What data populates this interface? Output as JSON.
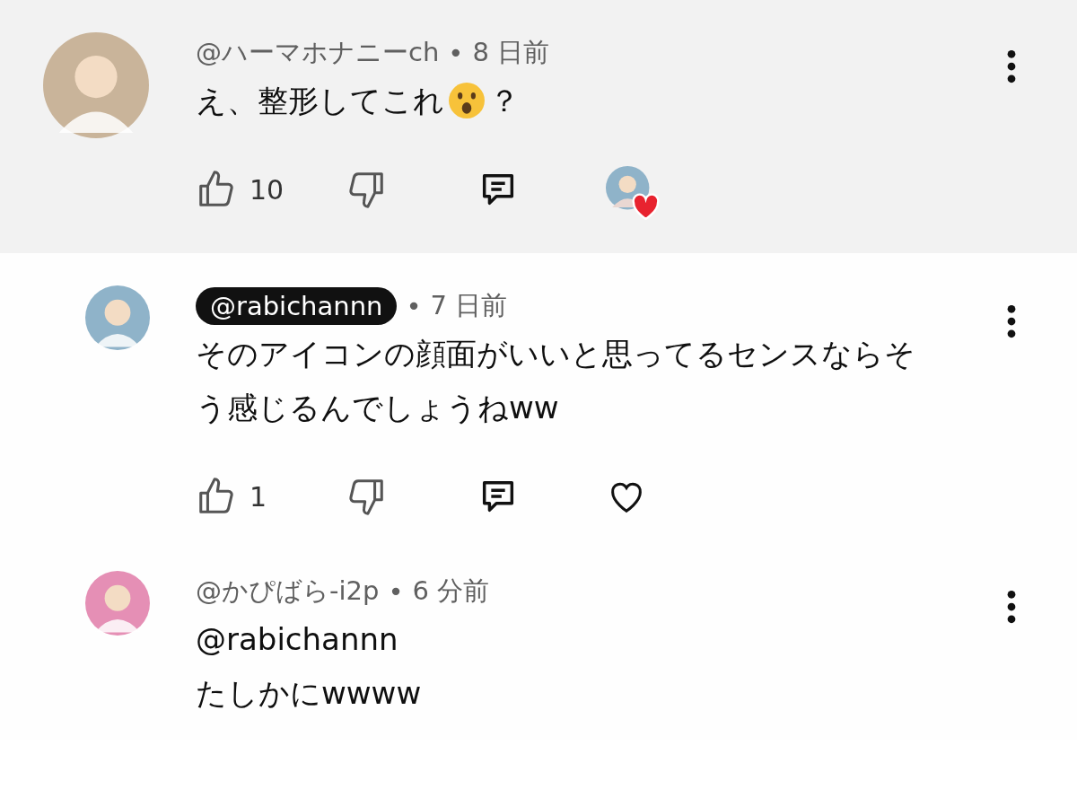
{
  "comments": [
    {
      "author": "@ハーマホナニーch",
      "creator_badge": false,
      "separator": "•",
      "time": "8 日前",
      "highlighted": true,
      "reply": false,
      "lines": [
        [
          {
            "kind": "text",
            "text": "え、整形してこれ"
          },
          {
            "kind": "emoji"
          },
          {
            "kind": "text",
            "text": "？"
          }
        ]
      ],
      "likes": "10",
      "hearted": true
    },
    {
      "author": "@rabichannn",
      "creator_badge": true,
      "separator": "•",
      "time": "7 日前",
      "highlighted": false,
      "reply": true,
      "lines": [
        [
          {
            "kind": "text",
            "text": "そのアイコンの顔面がいいと思ってるセンスならそ"
          }
        ],
        [
          {
            "kind": "text",
            "text": "う感じるんでしょうねww"
          }
        ]
      ],
      "likes": "1",
      "hearted": false
    },
    {
      "author": "@かぴばら-i2p",
      "creator_badge": false,
      "separator": "•",
      "time": "6 分前",
      "highlighted": false,
      "reply": true,
      "lines": [
        [
          {
            "kind": "text",
            "text": "@rabichannn"
          }
        ],
        [
          {
            "kind": "text",
            "text": "たしかにwwww"
          }
        ]
      ]
    }
  ]
}
